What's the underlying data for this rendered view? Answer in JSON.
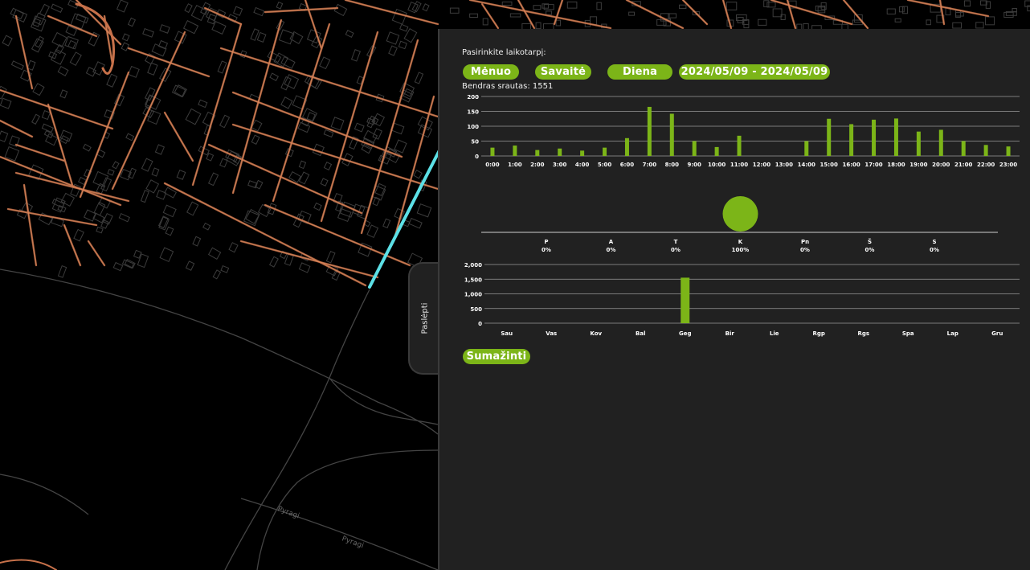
{
  "map": {
    "street_labels": [
      "Pyragi",
      "Pyragi"
    ]
  },
  "hide_tab": {
    "label": "Paslėpti"
  },
  "panel": {
    "period_label": "Pasirinkite laikotarpį:",
    "buttons": {
      "month": "Mėnuo",
      "week": "Savaitė",
      "day": "Diena"
    },
    "date_range": "2024/05/09 - 2024/05/09",
    "total_label": "Bendras srautas: 1551",
    "reduce_button": "Sumažinti"
  },
  "colors": {
    "accent": "#7cb518",
    "panel_bg": "#212121",
    "highlight_road": "#5ce0e6",
    "road": "#c7714a"
  },
  "chart_data": [
    {
      "type": "bar",
      "categories": [
        "0:00",
        "1:00",
        "2:00",
        "3:00",
        "4:00",
        "5:00",
        "6:00",
        "7:00",
        "8:00",
        "9:00",
        "10:00",
        "11:00",
        "12:00",
        "13:00",
        "14:00",
        "15:00",
        "16:00",
        "17:00",
        "18:00",
        "19:00",
        "20:00",
        "21:00",
        "22:00",
        "23:00"
      ],
      "values": [
        28,
        35,
        20,
        25,
        18,
        28,
        60,
        165,
        142,
        50,
        30,
        68,
        0,
        0,
        50,
        125,
        107,
        122,
        126,
        82,
        88,
        50,
        37,
        32
      ],
      "ylim": [
        0,
        200
      ],
      "yticks": [
        "0",
        "50",
        "100",
        "150",
        "200"
      ],
      "grid": true
    },
    {
      "type": "scatter",
      "categories": [
        "P",
        "A",
        "T",
        "K",
        "Pn",
        "Š",
        "S"
      ],
      "labels": [
        "0%",
        "0%",
        "0%",
        "100%",
        "0%",
        "0%",
        "0%"
      ],
      "values": [
        0,
        0,
        0,
        100,
        0,
        0,
        0
      ]
    },
    {
      "type": "bar",
      "categories": [
        "Sau",
        "Vas",
        "Kov",
        "Bal",
        "Geg",
        "Bir",
        "Lie",
        "Rgp",
        "Rgs",
        "Spa",
        "Lap",
        "Gru"
      ],
      "values": [
        0,
        0,
        0,
        0,
        1551,
        0,
        0,
        0,
        0,
        0,
        0,
        0
      ],
      "ylim": [
        0,
        2000
      ],
      "yticks": [
        "0",
        "500",
        "1,000",
        "1,500",
        "2,000"
      ],
      "grid": true
    }
  ]
}
